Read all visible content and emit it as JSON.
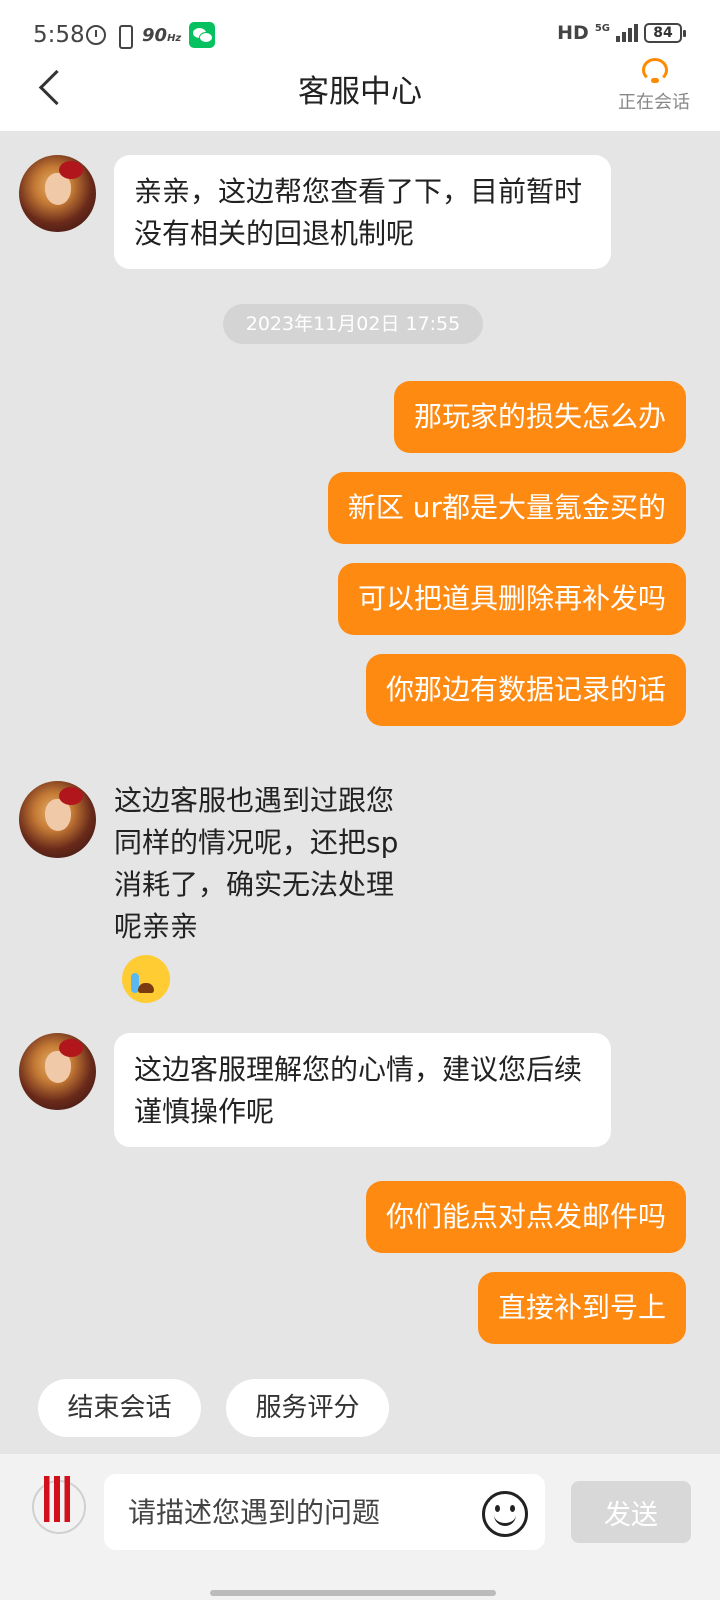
{
  "status_bar": {
    "time": "5:58",
    "refresh_rate": "90",
    "refresh_unit": "Hz",
    "network": "HD",
    "network_type": "5G",
    "battery": "84"
  },
  "header": {
    "title": "客服中心",
    "session_status": "正在会话",
    "accent_color": "#ff8a00"
  },
  "messages": {
    "m1": "亲亲，这边帮您查看了下，目前暂时没有相关的回退机制呢",
    "timestamp": "2023年11月02日 17:55",
    "u1": "那玩家的损失怎么办",
    "u2": "新区 ur都是大量氪金买的",
    "u3": "可以把道具删除再补发吗",
    "u4": "你那边有数据记录的话",
    "m2_line1": "这边客服也遇到过跟您",
    "m2_line2": "同样的情况呢，还把sp",
    "m2_line3": "消耗了，确实无法处理",
    "m2_line4": "呢亲亲",
    "m3": "这边客服理解您的心情，建议您后续谨慎操作呢",
    "u5": "你们能点对点发邮件吗",
    "u6": "直接补到号上"
  },
  "actions": {
    "end_session": "结束会话",
    "rate_service": "服务评分"
  },
  "input": {
    "placeholder": "请描述您遇到的问题",
    "send_label": "发送"
  },
  "colors": {
    "outgoing_bubble": "#ff8a12",
    "incoming_bubble": "#ffffff",
    "background": "#e5e5e5"
  }
}
